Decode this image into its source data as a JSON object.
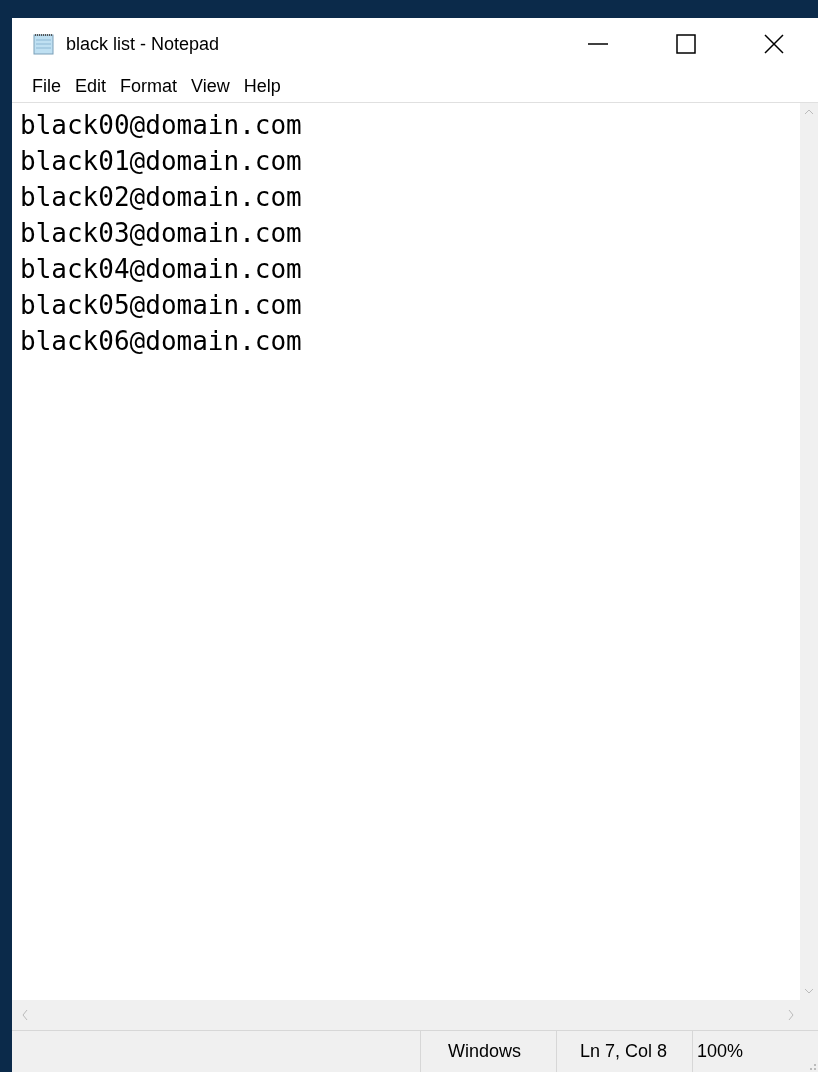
{
  "window": {
    "title": "black list - Notepad"
  },
  "menu": [
    "File",
    "Edit",
    "Format",
    "View",
    "Help"
  ],
  "lines": [
    "black00@domain.com",
    "black01@domain.com",
    "black02@domain.com",
    "black03@domain.com",
    "black04@domain.com",
    "black05@domain.com",
    "black06@domain.com"
  ],
  "status_bar": {
    "line_ending": "Windows",
    "position": "Ln 7, Col 8",
    "zoom": "100%"
  }
}
